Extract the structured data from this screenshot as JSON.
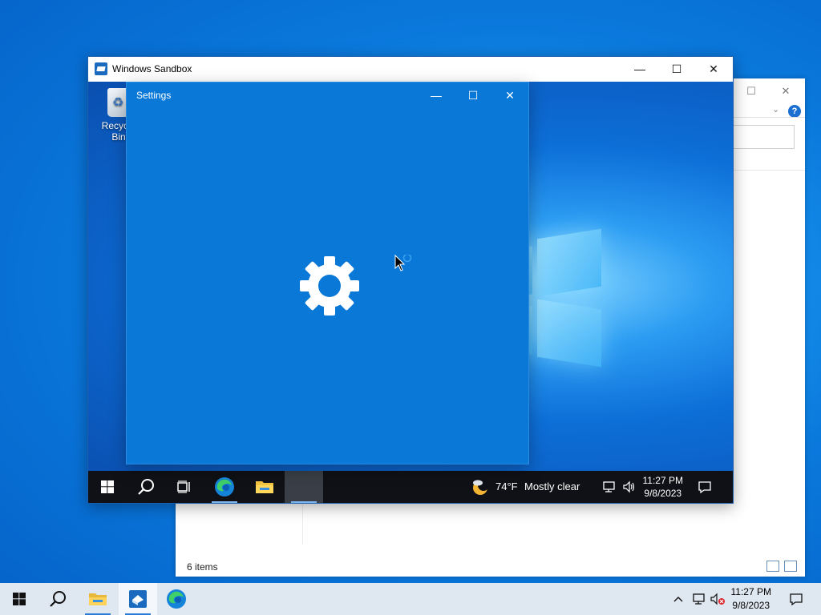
{
  "host": {
    "explorer": {
      "status_text": "6 items",
      "help_glyph": "?"
    },
    "taskbar": {
      "items": [
        {
          "name": "start-button",
          "icon": "windows-logo-icon"
        },
        {
          "name": "search-button",
          "icon": "search-icon"
        },
        {
          "name": "file-explorer",
          "icon": "folder-icon"
        },
        {
          "name": "windows-sandbox",
          "icon": "sandbox-icon"
        },
        {
          "name": "edge",
          "icon": "edge-icon"
        }
      ],
      "clock_time": "11:27 PM",
      "clock_date": "9/8/2023"
    }
  },
  "sandbox": {
    "title": "Windows Sandbox",
    "recycle_label": "Recycle Bin",
    "taskbar": {
      "weather_temp": "74°F",
      "weather_text": "Mostly clear",
      "clock_time": "11:27 PM",
      "clock_date": "9/8/2023"
    }
  },
  "settings": {
    "title": "Settings"
  },
  "colors": {
    "accent": "#0a78d7",
    "sandbox_bg": "#0a64c8",
    "host_taskbar": "#dfe7f1",
    "sandbox_taskbar": "#0f1116"
  }
}
